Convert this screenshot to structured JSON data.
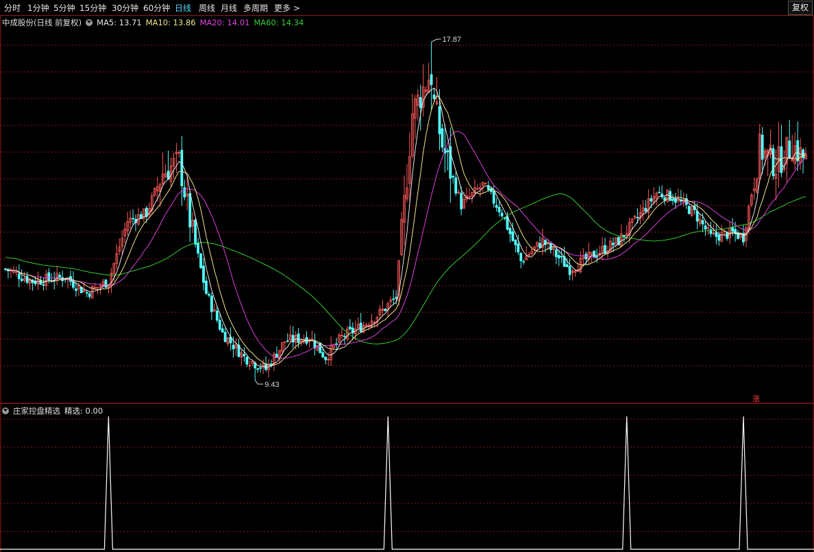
{
  "toolbar": {
    "tabs": [
      {
        "label": "分时",
        "active": false
      },
      {
        "label": "1分钟",
        "active": false
      },
      {
        "label": "5分钟",
        "active": false
      },
      {
        "label": "15分钟",
        "active": false
      },
      {
        "label": "30分钟",
        "active": false
      },
      {
        "label": "60分钟",
        "active": false
      },
      {
        "label": "日线",
        "active": true
      },
      {
        "label": "周线",
        "active": false
      },
      {
        "label": "月线",
        "active": false
      },
      {
        "label": "多周期",
        "active": false
      },
      {
        "label": "更多 >",
        "active": false
      }
    ],
    "fuquan_button": "复权"
  },
  "main_legend": {
    "title": "中成股份(日线 前复权)",
    "ma5": "MA5: 13.71",
    "ma10": "MA10: 13.86",
    "ma20": "MA20: 14.01",
    "ma60": "MA60: 14.34"
  },
  "indicator_legend": {
    "title": "庄家控盘精选",
    "value": "精选: 0.00"
  },
  "annotations": {
    "high_label": "17.87",
    "low_label": "9.43",
    "zhang_badge": "涨"
  },
  "colors": {
    "up": "#ff5a5a",
    "down": "#54ffff",
    "ma5": "#e6e6e6",
    "ma10": "#f0e68c",
    "ma20": "#e040e0",
    "ma60": "#33cc33",
    "accent": "#5fd7ff",
    "grid": "#8b1a1a"
  },
  "chart_data": [
    {
      "type": "candlestick",
      "title": "中成股份(日线 前复权)",
      "series_names": [
        "MA5",
        "MA10",
        "MA20",
        "MA60"
      ],
      "latest_values": {
        "MA5": 13.71,
        "MA10": 13.86,
        "MA20": 14.01,
        "MA60": 14.34
      },
      "marked_high": 17.87,
      "marked_low": 9.43,
      "ylim": [
        9.0,
        18.3
      ]
    },
    {
      "type": "line",
      "title": "庄家控盘精选",
      "series_names": [
        "精选"
      ],
      "latest_value": 0.0,
      "peaks_at_candle_index": [
        38,
        141,
        229,
        272
      ]
    }
  ]
}
